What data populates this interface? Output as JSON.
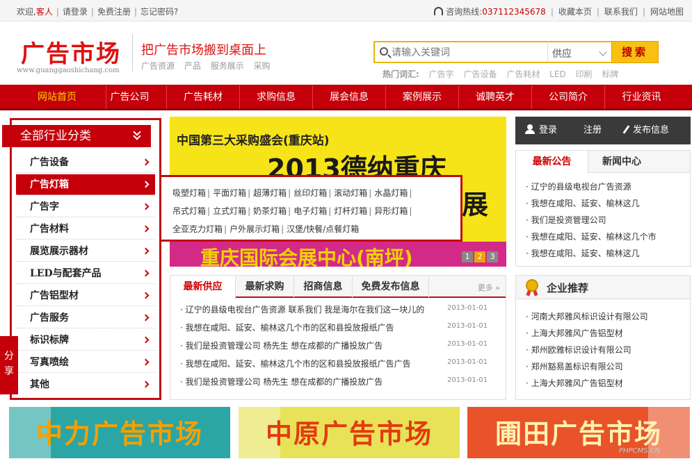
{
  "topbar": {
    "welcome": "欢迎,",
    "guest": "客人",
    "login": "请登录",
    "register": "免费注册",
    "forgot": "忘记密码?",
    "hotline_label": "咨询热线:",
    "hotline": "037112345678",
    "favorite": "收藏本页",
    "contact": "联系我们",
    "sitemap": "网站地图"
  },
  "header": {
    "logo": "广告市场",
    "logo_url": "www.guanggaoshichang.com",
    "slogan": "把广告市场搬到桌面上",
    "subnav": [
      "广告资源",
      "产品",
      "服务展示",
      "采购"
    ]
  },
  "search": {
    "placeholder": "请输入关键词",
    "select": "供应",
    "button": "搜索",
    "hot_label": "热门词汇:",
    "hot": [
      "广告字",
      "广告设备",
      "广告耗材",
      "LED",
      "印刷",
      "标牌"
    ]
  },
  "nav": [
    "网站首页",
    "广告公司",
    "广告耗材",
    "求购信息",
    "展会信息",
    "案例展示",
    "诚聘英才",
    "公司简介",
    "行业资讯"
  ],
  "categories": {
    "title": "全部行业分类",
    "items": [
      "广告设备",
      "广告灯箱",
      "广告字",
      "广告材料",
      "展览展示器材",
      "LED与配套产品",
      "广告铝型材",
      "广告服务",
      "标识标牌",
      "写真喷绘",
      "其他"
    ]
  },
  "flyout": {
    "line1": [
      "吸塑灯箱",
      "平面灯箱",
      "超薄灯箱",
      "丝印灯箱",
      "滚动灯箱",
      "水晶灯箱"
    ],
    "line2": [
      "吊式灯箱",
      "立式灯箱",
      "奶茶灯箱",
      "电子灯箱",
      "灯杆灯箱",
      "异形灯箱"
    ],
    "line3": [
      "全亚克力灯箱",
      "户外展示灯箱",
      "汉堡/快餐/点餐灯箱"
    ]
  },
  "share": "分享",
  "banner": {
    "line1": "中国第三大采购盛会(重庆站)",
    "line2": "2013德纳重庆",
    "line3": "展",
    "line4": "重庆国际会展中心(南坪)",
    "dots": [
      "1",
      "2",
      "3"
    ]
  },
  "supply": {
    "tabs": [
      "最新供应",
      "最新求购",
      "招商信息",
      "免费发布信息"
    ],
    "more": "更多",
    "rows": [
      {
        "text": "辽宁的县级电视台广告资源 联系我们 我是海尔在我们这一块儿的",
        "date": "2013-01-01"
      },
      {
        "text": "我想在咸阳、延安、榆林这几个市的区和县投放报纸广告",
        "date": "2013-01-01"
      },
      {
        "text": "我们是投资管理公司 杨先生 想在成都的广播投放广告",
        "date": "2013-01-01"
      },
      {
        "text": "我想在咸阳、延安、榆林这几个市的区和县投放报纸广告广告",
        "date": "2013-01-01"
      },
      {
        "text": "我们是投资管理公司 杨先生 想在成都的广播投放广告",
        "date": "2013-01-01"
      }
    ]
  },
  "userbar": {
    "login": "登录",
    "register": "注册",
    "publish": "发布信息"
  },
  "news": {
    "tabs": [
      "最新公告",
      "新闻中心"
    ],
    "rows": [
      "辽宁的县级电视台广告资源",
      "我想在咸阳、延安、榆林这几",
      "我们是投资管理公司",
      "我想在咸阳、延安、榆林这几个市",
      "我想在咸阳、延安、榆林这几"
    ]
  },
  "enterprise": {
    "title": "企业推荐",
    "rows": [
      "河南大邦雅风标识设计有限公司",
      "上海大邦雅风广告铝型材",
      "郑州欧雅标识设计有限公司",
      "郑州豁易盖标识有限公司",
      "上海大邦雅风广告铝型材"
    ]
  },
  "ads": [
    "中力广告市场",
    "中原广告市场",
    "圃田广告市场"
  ],
  "watermark": "PHPCMS.CN",
  "colors": {
    "brand_red": "#c6000b",
    "accent_yellow": "#f8c010"
  }
}
